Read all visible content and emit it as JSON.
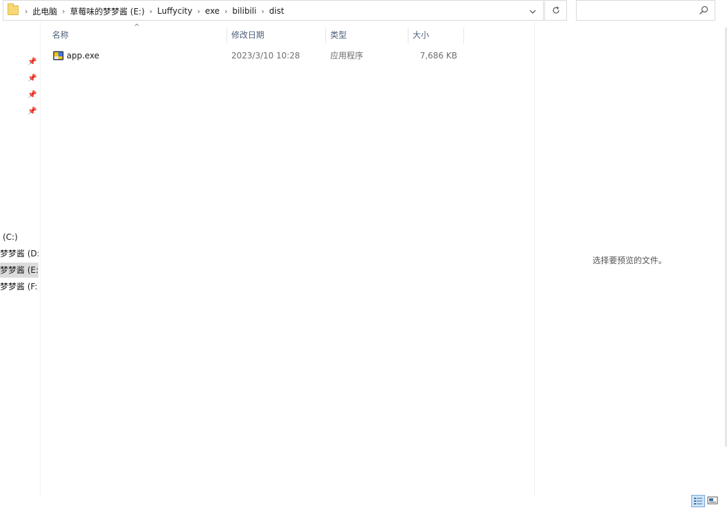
{
  "address_bar": {
    "breadcrumbs": [
      "此电脑",
      "草莓味的梦梦酱 (E:)",
      "Luffycity",
      "exe",
      "bilibili",
      "dist"
    ]
  },
  "search": {
    "placeholder": ""
  },
  "nav_pane": {
    "drives": [
      "(C:)",
      "梦梦酱 (D:",
      "梦梦酱 (E:",
      "梦梦酱 (F:)"
    ],
    "selected_drive_index": 2
  },
  "columns": {
    "name": "名称",
    "date_modified": "修改日期",
    "type": "类型",
    "size": "大小"
  },
  "files": [
    {
      "name": "app.exe",
      "date_modified": "2023/3/10 10:28",
      "type": "应用程序",
      "size": "7,686 KB"
    }
  ],
  "preview": {
    "message": "选择要预览的文件。"
  },
  "icons": {
    "folder": "folder-icon",
    "dropdown": "chevron-down-icon",
    "refresh": "refresh-icon",
    "search": "search-icon",
    "pin": "pin-icon",
    "details_view": "details-view-icon",
    "large_icons_view": "large-icons-view-icon"
  },
  "colors": {
    "selected_drive": "#dcdcdc",
    "column_header_text": "#4c607a",
    "active_view_button": "#cce4f7"
  }
}
